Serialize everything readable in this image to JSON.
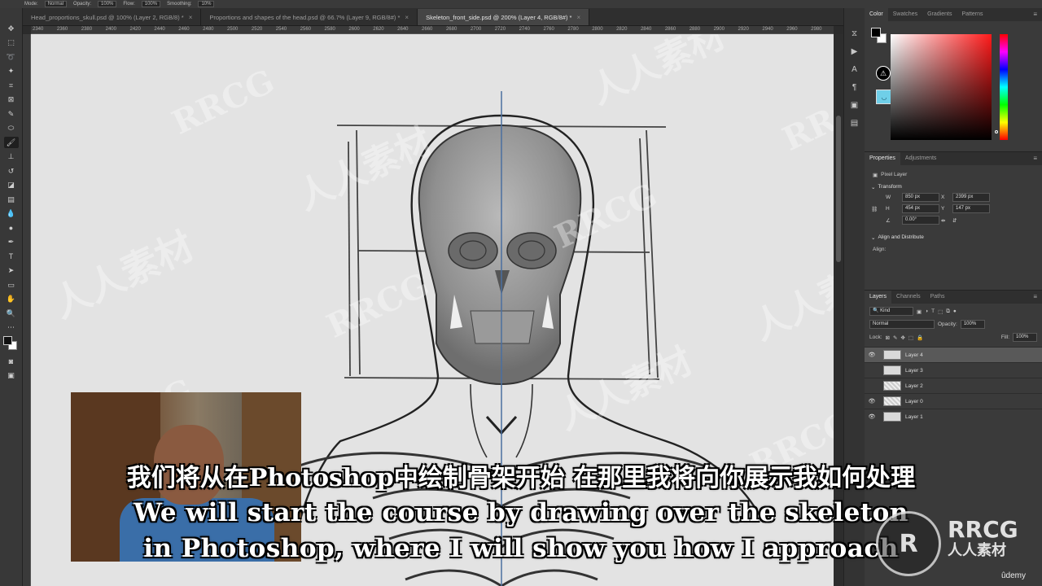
{
  "options_bar": {
    "mode_label": "Mode:",
    "mode_value": "Normal",
    "opacity_label": "Opacity:",
    "opacity_value": "100%",
    "flow_label": "Flow:",
    "flow_value": "100%",
    "smoothing_label": "Smoothing:",
    "smoothing_value": "10%"
  },
  "tabs": [
    {
      "label": "Head_proportions_skull.psd @ 100% (Layer 2, RGB/8) *"
    },
    {
      "label": "Proportions and shapes of the head.psd @ 66.7% (Layer 9, RGB/8#) *"
    },
    {
      "label": "Skeleton_front_side.psd @ 200% (Layer 4, RGB/8#) *"
    }
  ],
  "ruler_ticks": [
    "2340",
    "2360",
    "2380",
    "2400",
    "2420",
    "2440",
    "2460",
    "2480",
    "2500",
    "2520",
    "2540",
    "2560",
    "2580",
    "2600",
    "2620",
    "2640",
    "2660",
    "2680",
    "2700",
    "2720",
    "2740",
    "2760",
    "2780",
    "2800",
    "2820",
    "2840",
    "2860",
    "2880",
    "2900",
    "2920",
    "2940",
    "2960",
    "2980"
  ],
  "color_panel": {
    "tabs": [
      "Color",
      "Swatches",
      "Gradients",
      "Patterns"
    ],
    "accent": "#6fcfe8"
  },
  "properties": {
    "tabs": [
      "Properties",
      "Adjustments"
    ],
    "pixel_layer": "Pixel Layer",
    "transform_title": "Transform",
    "w_label": "W",
    "w_value": "850 px",
    "h_label": "H",
    "h_value": "454 px",
    "x_label": "X",
    "x_value": "2399 px",
    "y_label": "Y",
    "y_value": "147 px",
    "angle_value": "0.00°",
    "align_title": "Align and Distribute",
    "align_label": "Align:"
  },
  "layers": {
    "tabs": [
      "Layers",
      "Channels",
      "Paths"
    ],
    "kind_label": "Kind",
    "blend_mode": "Normal",
    "opacity_label": "Opacity:",
    "opacity_value": "100%",
    "lock_label": "Lock:",
    "fill_label": "Fill:",
    "fill_value": "100%",
    "items": [
      {
        "name": "Layer 4",
        "visible": true,
        "selected": true
      },
      {
        "name": "Layer 3",
        "visible": false,
        "selected": false
      },
      {
        "name": "Layer 2",
        "visible": false,
        "selected": false
      },
      {
        "name": "Layer 0",
        "visible": true,
        "selected": false
      },
      {
        "name": "Layer 1",
        "visible": true,
        "selected": false
      }
    ]
  },
  "subtitles": {
    "zh": "我们将从在Photoshop中绘制骨架开始 在那里我将向你展示我如何处理",
    "en_line1": "We will start the course by drawing over the skeleton",
    "en_line2": "in Photoshop, where I will show you how I approach"
  },
  "watermarks": {
    "brand": "RRCG",
    "cn": "人人素材"
  },
  "udemy": "ûdemy"
}
